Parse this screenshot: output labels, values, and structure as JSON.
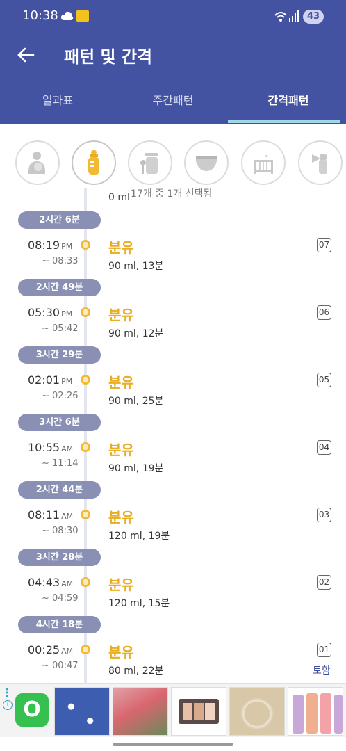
{
  "status": {
    "time": "10:38",
    "battery": "43"
  },
  "header": {
    "title": "패턴 및 간격"
  },
  "tabs": [
    "일과표",
    "주간패턴",
    "간격패턴"
  ],
  "categories": [
    {
      "icon": "feeding-mother-icon"
    },
    {
      "icon": "baby-bottle-icon"
    },
    {
      "icon": "baby-food-icon"
    },
    {
      "icon": "diaper-icon"
    },
    {
      "icon": "crib-sleep-icon"
    },
    {
      "icon": "breast-pump-icon"
    }
  ],
  "selection_text": "17개 중 1개 선택됨",
  "partial_detail": "0 ml",
  "entries": [
    {
      "gap": "2시간 6분",
      "time": "08:19",
      "ampm": "PM",
      "end": "~ 08:33",
      "title": "분유",
      "detail": "90 ml, 13분",
      "index": "07"
    },
    {
      "gap": "2시간 49분",
      "time": "05:30",
      "ampm": "PM",
      "end": "~ 05:42",
      "title": "분유",
      "detail": "90 ml, 12분",
      "index": "06"
    },
    {
      "gap": "3시간 29분",
      "time": "02:01",
      "ampm": "PM",
      "end": "~ 02:26",
      "title": "분유",
      "detail": "90 ml, 25분",
      "index": "05"
    },
    {
      "gap": "3시간 6분",
      "time": "10:55",
      "ampm": "AM",
      "end": "~ 11:14",
      "title": "분유",
      "detail": "90 ml, 19분",
      "index": "04"
    },
    {
      "gap": "2시간 44분",
      "time": "08:11",
      "ampm": "AM",
      "end": "~ 08:30",
      "title": "분유",
      "detail": "120 ml, 19분",
      "index": "03"
    },
    {
      "gap": "3시간 28분",
      "time": "04:43",
      "ampm": "AM",
      "end": "~ 04:59",
      "title": "분유",
      "detail": "120 ml, 15분",
      "index": "02"
    },
    {
      "gap": "4시간 18분",
      "time": "00:25",
      "ampm": "AM",
      "end": "~ 00:47",
      "title": "분유",
      "detail": "80 ml, 22분",
      "index": "01"
    }
  ],
  "total_label": "토함",
  "ad": {
    "logo_letter": "O"
  },
  "colors": {
    "header": "#4353a2",
    "accent": "#e8ad22",
    "gap_badge": "#8a90b4"
  }
}
